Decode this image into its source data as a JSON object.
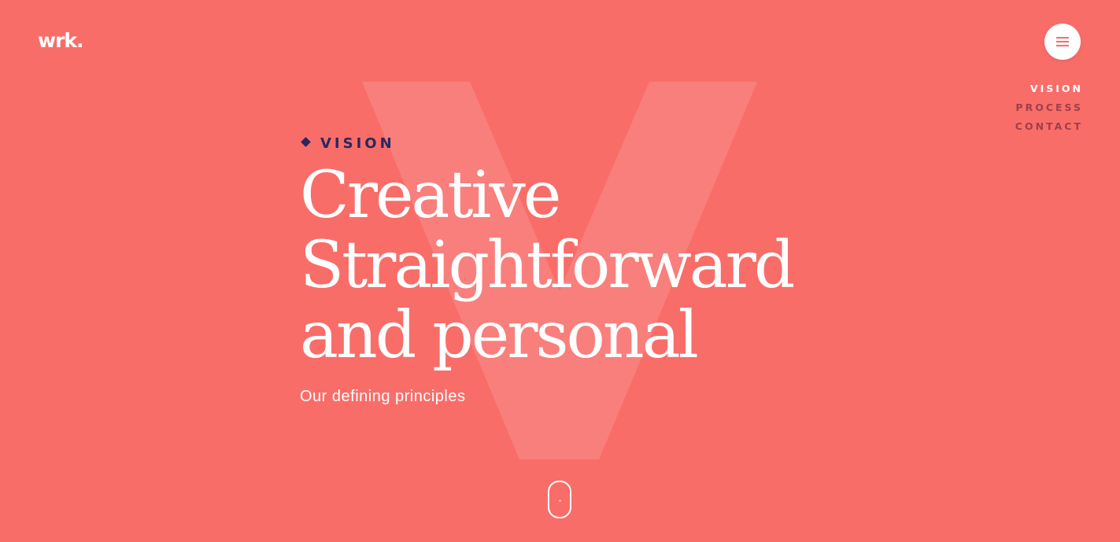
{
  "brand": {
    "logo_text": "wrk.",
    "background_color": "#f96d69",
    "accent_dark": "#29285e",
    "nav_inactive_color": "#9c3f4c"
  },
  "header": {
    "menu_icon": "hamburger-icon"
  },
  "side_nav": {
    "items": [
      {
        "label": "VISION",
        "active": true
      },
      {
        "label": "PROCESS",
        "active": false
      },
      {
        "label": "CONTACT",
        "active": false
      }
    ]
  },
  "hero": {
    "background_letter": "V",
    "eyebrow_icon": "diamond-icon",
    "eyebrow": "VISION",
    "headline_lines": [
      "Creative",
      "Straightforward",
      "and personal"
    ],
    "subtitle": "Our defining principles"
  },
  "scroll": {
    "icon": "mouse-scroll-icon"
  }
}
